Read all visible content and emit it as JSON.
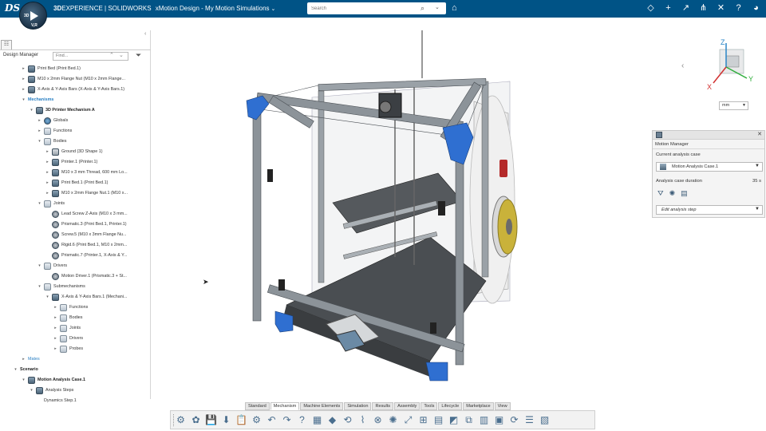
{
  "header": {
    "brand_bold": "3D",
    "brand": "EXPERIENCE | SOLIDWORKS",
    "app": "xMotion Design - My Motion Simulations",
    "search_placeholder": "Search",
    "compass_labels": {
      "top": "3D",
      "right": "V,R",
      "left": "",
      "bottom": ""
    }
  },
  "panel": {
    "title": "Design Manager",
    "find_placeholder": "Find...",
    "tree": [
      {
        "indent": 1,
        "arrow": "▸",
        "icon": "part",
        "label": "Print Bed (Print Bed.1)",
        "style": ""
      },
      {
        "indent": 1,
        "arrow": "▸",
        "icon": "part",
        "label": "M10 x 2mm Flange Nut (M10 x 2mm Flange...",
        "style": ""
      },
      {
        "indent": 1,
        "arrow": "▸",
        "icon": "part",
        "label": "X-Axis & Y-Axis Bars (X-Axis & Y-Axis Bars.1)",
        "style": ""
      },
      {
        "indent": 1,
        "arrow": "▾",
        "icon": "",
        "label": "Mechanisms",
        "style": "bold-blue"
      },
      {
        "indent": 2,
        "arrow": "▾",
        "icon": "part",
        "label": "3D Printer Mechanism A",
        "style": "bold"
      },
      {
        "indent": 3,
        "arrow": "▸",
        "icon": "globe",
        "label": "Globals",
        "style": ""
      },
      {
        "indent": 3,
        "arrow": "▸",
        "icon": "folder",
        "label": "Functions",
        "style": ""
      },
      {
        "indent": 3,
        "arrow": "▾",
        "icon": "folder",
        "label": "Bodies",
        "style": ""
      },
      {
        "indent": 4,
        "arrow": "▸",
        "icon": "ground",
        "label": "Ground (3D Shape 1)",
        "style": ""
      },
      {
        "indent": 4,
        "arrow": "▸",
        "icon": "part",
        "label": "Printer.1 (Printer.1)",
        "style": ""
      },
      {
        "indent": 4,
        "arrow": "▸",
        "icon": "part",
        "label": "M10 x 3 mm Thread, 600 mm Lo...",
        "style": ""
      },
      {
        "indent": 4,
        "arrow": "▸",
        "icon": "part",
        "label": "Print Bed.1 (Print Bed.1)",
        "style": ""
      },
      {
        "indent": 4,
        "arrow": "▸",
        "icon": "part",
        "label": "M10 x 2mm Flange Nut.1 (M10 x...",
        "style": ""
      },
      {
        "indent": 3,
        "arrow": "▾",
        "icon": "folder",
        "label": "Joints",
        "style": ""
      },
      {
        "indent": 4,
        "arrow": "",
        "icon": "joint",
        "label": "Lead Screw Z-Axis (M10 x 3 mm...",
        "style": ""
      },
      {
        "indent": 4,
        "arrow": "",
        "icon": "joint",
        "label": "Prismatic.3 (Print Bed.1, Printer.1)",
        "style": ""
      },
      {
        "indent": 4,
        "arrow": "",
        "icon": "joint",
        "label": "Screw.5 (M10 x 3mm Flange Nu...",
        "style": ""
      },
      {
        "indent": 4,
        "arrow": "",
        "icon": "joint",
        "label": "Rigid.6 (Print Bed.1, M10 x 2mm...",
        "style": ""
      },
      {
        "indent": 4,
        "arrow": "",
        "icon": "joint",
        "label": "Prismatic.7 (Printer.1, X-Axis & Y...",
        "style": ""
      },
      {
        "indent": 3,
        "arrow": "▾",
        "icon": "folder",
        "label": "Drivers",
        "style": ""
      },
      {
        "indent": 4,
        "arrow": "",
        "icon": "joint",
        "label": "Motion Driver.1 (Prismatic.3 + St...",
        "style": ""
      },
      {
        "indent": 3,
        "arrow": "▾",
        "icon": "folder",
        "label": "Submechanisms",
        "style": ""
      },
      {
        "indent": 4,
        "arrow": "▾",
        "icon": "part",
        "label": "X-Axis & Y-Axis Bars.1 (Mechani...",
        "style": ""
      },
      {
        "indent": 5,
        "arrow": "▸",
        "icon": "folder",
        "label": "Functions",
        "style": ""
      },
      {
        "indent": 5,
        "arrow": "▸",
        "icon": "folder",
        "label": "Bodies",
        "style": ""
      },
      {
        "indent": 5,
        "arrow": "▸",
        "icon": "folder",
        "label": "Joints",
        "style": ""
      },
      {
        "indent": 5,
        "arrow": "▸",
        "icon": "folder",
        "label": "Drivers",
        "style": ""
      },
      {
        "indent": 5,
        "arrow": "▸",
        "icon": "folder",
        "label": "Probes",
        "style": ""
      },
      {
        "indent": 1,
        "arrow": "▸",
        "icon": "",
        "label": "Mates",
        "style": "blue"
      },
      {
        "indent": 0,
        "arrow": "▾",
        "icon": "",
        "label": "Scenario",
        "style": "bold"
      },
      {
        "indent": 1,
        "arrow": "▾",
        "icon": "part",
        "label": "Motion Analysis Case.1",
        "style": "bold"
      },
      {
        "indent": 2,
        "arrow": "▾",
        "icon": "part",
        "label": "Analysis Steps",
        "style": ""
      },
      {
        "indent": 3,
        "arrow": "",
        "icon": "",
        "label": "Dynamics Step.1",
        "style": ""
      }
    ]
  },
  "viewport": {
    "unit": "mm",
    "axes": {
      "z": "Z",
      "y": "Y",
      "x": "X"
    },
    "colors": {
      "frame": "#8c9399",
      "corner": "#2f6fd1",
      "panel": "#3f4347",
      "spool": "#c9b23a"
    }
  },
  "motion_manager": {
    "title": "Motion Manager",
    "current_label": "Current analysis case",
    "current_value": "Motion Analysis Case.1",
    "duration_label": "Analysis case duration",
    "duration_value": "35 s",
    "edit_step": "Edit analysis step"
  },
  "tabs": [
    {
      "label": "Standard",
      "active": false
    },
    {
      "label": "Mechanism",
      "active": true
    },
    {
      "label": "Machine Elements",
      "active": false
    },
    {
      "label": "Simulation",
      "active": false
    },
    {
      "label": "Results",
      "active": false
    },
    {
      "label": "Assembly",
      "active": false
    },
    {
      "label": "Tools",
      "active": false
    },
    {
      "label": "Lifecycle",
      "active": false
    },
    {
      "label": "Marketplace",
      "active": false
    },
    {
      "label": "View",
      "active": false
    }
  ],
  "toolbar": [
    {
      "name": "mechanism-icon",
      "glyph": "⚙"
    },
    {
      "name": "assembly-icon",
      "glyph": "✿"
    },
    {
      "name": "save-icon",
      "glyph": "💾"
    },
    {
      "name": "save-as-icon",
      "glyph": "⬇"
    },
    {
      "name": "clipboard-icon",
      "glyph": "📋"
    },
    {
      "name": "settings-icon",
      "glyph": "⚙"
    },
    {
      "name": "undo-icon",
      "glyph": "↶"
    },
    {
      "name": "redo-icon",
      "glyph": "↷"
    },
    {
      "name": "help-icon",
      "glyph": "?"
    },
    {
      "name": "body-icon",
      "glyph": "▦"
    },
    {
      "name": "ground-icon",
      "glyph": "◆"
    },
    {
      "name": "joint-icon",
      "glyph": "⟲"
    },
    {
      "name": "spring-icon",
      "glyph": "⌇"
    },
    {
      "name": "connector-icon",
      "glyph": "⊗"
    },
    {
      "name": "gear-icon",
      "glyph": "✺"
    },
    {
      "name": "lever-icon",
      "glyph": "⤢"
    },
    {
      "name": "measure-icon",
      "glyph": "⊞"
    },
    {
      "name": "plot-icon",
      "glyph": "▤"
    },
    {
      "name": "cam-icon",
      "glyph": "◩"
    },
    {
      "name": "driver-icon",
      "glyph": "⧉"
    },
    {
      "name": "sensor-icon",
      "glyph": "▥"
    },
    {
      "name": "simulate-icon",
      "glyph": "▣"
    },
    {
      "name": "animation-icon",
      "glyph": "⟳"
    },
    {
      "name": "results-icon",
      "glyph": "☰"
    },
    {
      "name": "report-icon",
      "glyph": "▧"
    }
  ]
}
